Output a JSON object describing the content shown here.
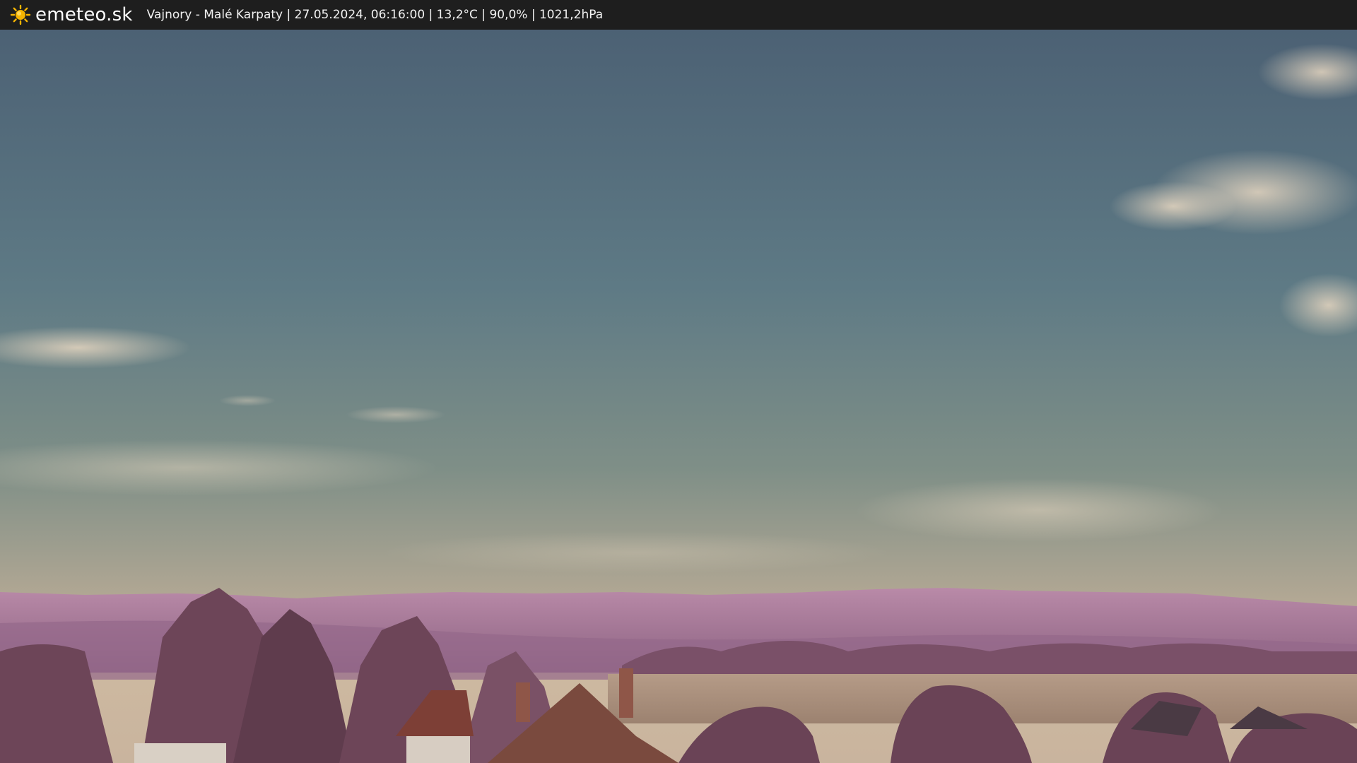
{
  "header": {
    "brand": "emeteo.sk",
    "caption": "Vajnory - Malé Karpaty | 27.05.2024, 06:16:00 | 13,2°C | 90,0% | 1021,2hPa",
    "logo_icon": "sun-icon",
    "background_color": "#1e1e1e",
    "sun_color": "#f5b400"
  },
  "scene": {
    "description_icon": "webcam-landscape-image",
    "sky_top_color": "#4f6678",
    "sky_horizon_color": "#c9b59c",
    "hills_color": "#a67a97",
    "trees_color": "#6e4658"
  }
}
